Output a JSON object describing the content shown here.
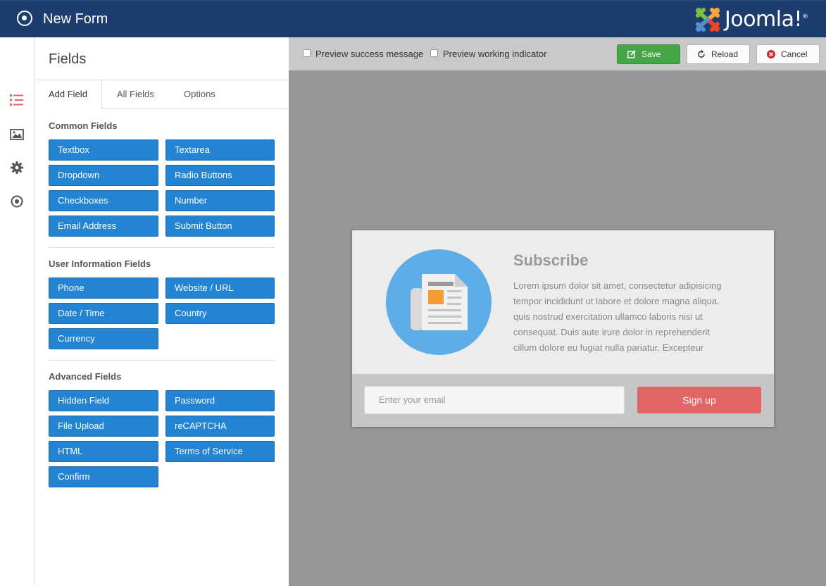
{
  "header": {
    "title": "New Form",
    "logo_text": "Joomla!",
    "logo_mark": "®"
  },
  "rail": {
    "icons": [
      "list-icon",
      "image-icon",
      "gear-icon",
      "target-icon"
    ]
  },
  "panel": {
    "title": "Fields",
    "tabs": [
      {
        "label": "Add Field"
      },
      {
        "label": "All Fields"
      },
      {
        "label": "Options"
      }
    ],
    "sections": [
      {
        "title": "Common Fields",
        "buttons": [
          "Textbox",
          "Textarea",
          "Dropdown",
          "Radio Buttons",
          "Checkboxes",
          "Number",
          "Email Address",
          "Submit Button"
        ]
      },
      {
        "title": "User Information Fields",
        "buttons": [
          "Phone",
          "Website / URL",
          "Date / Time",
          "Country",
          "Currency"
        ]
      },
      {
        "title": "Advanced Fields",
        "buttons": [
          "Hidden Field",
          "Password",
          "File Upload",
          "reCAPTCHA",
          "HTML",
          "Terms of Service",
          "Confirm"
        ]
      }
    ]
  },
  "toolbar": {
    "preview_success": "Preview success message",
    "preview_working": "Preview working indicator",
    "save": "Save",
    "reload": "Reload",
    "cancel": "Cancel"
  },
  "preview": {
    "heading": "Subscribe",
    "body": "Lorem ipsum dolor sit amet, consectetur adipisicing tempor incididunt ut labore et dolore magna aliqua. quis nostrud exercitation ullamco laboris nisi ut consequat. Duis aute irure dolor in reprehenderit cillum dolore eu fugiat nulla pariatur. Excepteur",
    "email_placeholder": "Enter your email",
    "signup": "Sign up"
  },
  "colors": {
    "header": "#1c3d6e",
    "field_button": "#2384d3",
    "save": "#46a546",
    "signup": "#e26565",
    "circle": "#5dade8"
  }
}
